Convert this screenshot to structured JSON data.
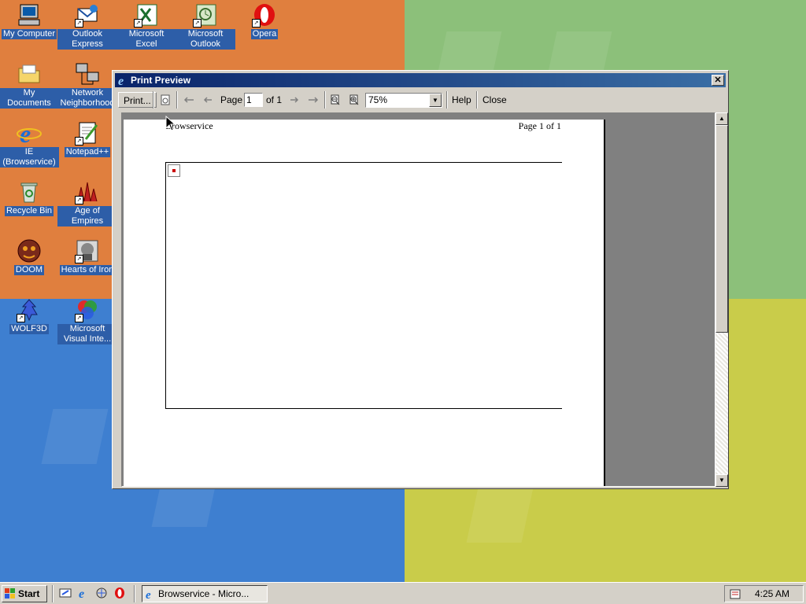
{
  "desktop": {
    "icons": [
      {
        "label": "My Computer"
      },
      {
        "label": "Outlook Express"
      },
      {
        "label": "Microsoft Excel"
      },
      {
        "label": "Microsoft Outlook"
      },
      {
        "label": "Opera"
      },
      {
        "label": "My Documents"
      },
      {
        "label": "Network Neighborhood"
      },
      {
        "label": "IE (Browservice)"
      },
      {
        "label": "Notepad++"
      },
      {
        "label": "Recycle Bin"
      },
      {
        "label": "Age of Empires"
      },
      {
        "label": "DOOM"
      },
      {
        "label": "Hearts of Iron"
      },
      {
        "label": "WOLF3D"
      },
      {
        "label": "Microsoft Visual Inte..."
      }
    ]
  },
  "window": {
    "title": "Print Preview",
    "close_glyph": "✕",
    "toolbar": {
      "print_label": "Print...",
      "page_label": "Page",
      "page_value": "1",
      "page_of": "of 1",
      "zoom_value": "75%",
      "help_label": "Help",
      "close_label": "Close"
    },
    "page": {
      "header_left": "Browservice",
      "header_right": "Page 1 of 1"
    }
  },
  "taskbar": {
    "start_label": "Start",
    "task_label": "Browservice - Micro...",
    "clock": "4:25 AM"
  },
  "colors": {
    "title_start": "#0a246a",
    "title_end": "#3a6ea5",
    "chrome": "#d4d0c8"
  },
  "icons": [
    "ie-icon",
    "print-icon",
    "page-setup-icon",
    "first-page-icon",
    "prev-page-icon",
    "next-page-icon",
    "last-page-icon",
    "zoom-out-icon",
    "zoom-in-icon",
    "windows-flag-icon",
    "clock-tray-icon"
  ]
}
